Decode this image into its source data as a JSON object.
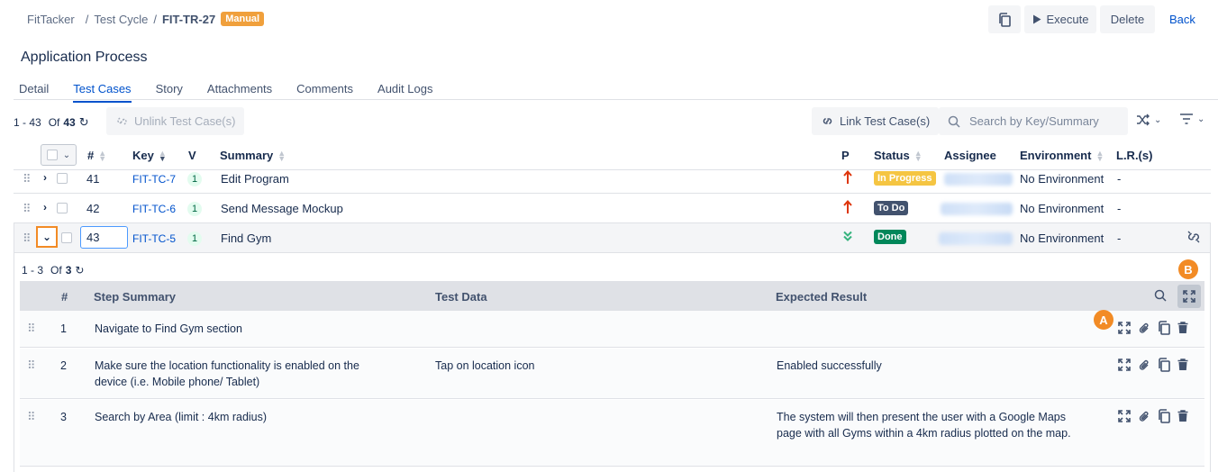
{
  "breadcrumb": {
    "root": "FitTacker",
    "sep1": "/",
    "cycle": "Test Cycle",
    "sep2": "/",
    "current": "FIT-TR-27",
    "badge": "Manual"
  },
  "header": {
    "copy_icon": "copy-icon",
    "execute_label": "Execute",
    "delete_label": "Delete",
    "back_label": "Back"
  },
  "page_title": "Application Process",
  "tabs": [
    {
      "label": "Detail"
    },
    {
      "label": "Test Cases",
      "active": true
    },
    {
      "label": "Story"
    },
    {
      "label": "Attachments"
    },
    {
      "label": "Comments"
    },
    {
      "label": "Audit Logs"
    }
  ],
  "toolbar": {
    "range": "1 - 43",
    "of": "Of",
    "total": "43",
    "unlink_label": "Unlink Test Case(s)",
    "link_label": "Link Test Case(s)",
    "search_placeholder": "Search by Key/Summary"
  },
  "columns": {
    "num": "#",
    "key": "Key",
    "version": "V",
    "summary": "Summary",
    "priority": "P",
    "status": "Status",
    "assignee": "Assignee",
    "environment": "Environment",
    "lr": "L.R.(s)"
  },
  "rows": [
    {
      "num": "41",
      "key": "FIT-TC-7",
      "version": "1",
      "summary": "Edit Program",
      "priority": "high",
      "status": "In Progress",
      "status_color": "#f5c542",
      "environment": "No Environment",
      "lr": "-"
    },
    {
      "num": "42",
      "key": "FIT-TC-6",
      "version": "1",
      "summary": "Send Message Mockup",
      "priority": "high",
      "status": "To Do",
      "status_color": "#42526e",
      "environment": "No Environment",
      "lr": "-"
    },
    {
      "num": "43",
      "key": "FIT-TC-5",
      "version": "1",
      "summary": "Find Gym",
      "priority": "low",
      "status": "Done",
      "status_color": "#00875a",
      "environment": "No Environment",
      "lr": "-"
    }
  ],
  "steps": {
    "range": "1 - 3",
    "of": "Of",
    "total": "3",
    "columns": {
      "num": "#",
      "summary": "Step Summary",
      "data": "Test Data",
      "expected": "Expected Result"
    },
    "items": [
      {
        "num": "1",
        "summary": "Navigate to Find Gym section",
        "data": "",
        "expected": ""
      },
      {
        "num": "2",
        "summary": "Make sure the location functionality is enabled on the device (i.e. Mobile phone/ Tablet)",
        "data": "Tap on location icon",
        "expected": "Enabled successfully"
      },
      {
        "num": "3",
        "summary": "Search by Area (limit : 4km radius)",
        "data": "",
        "expected": "The system will then present the user with a Google Maps page with all Gyms within a 4km radius plotted on the map."
      }
    ]
  },
  "callouts": {
    "a": "A",
    "b": "B"
  },
  "colors": {
    "accent": "#0052cc",
    "callout": "#f28b25",
    "high_priority": "#de350b",
    "low_priority": "#36b37e"
  }
}
